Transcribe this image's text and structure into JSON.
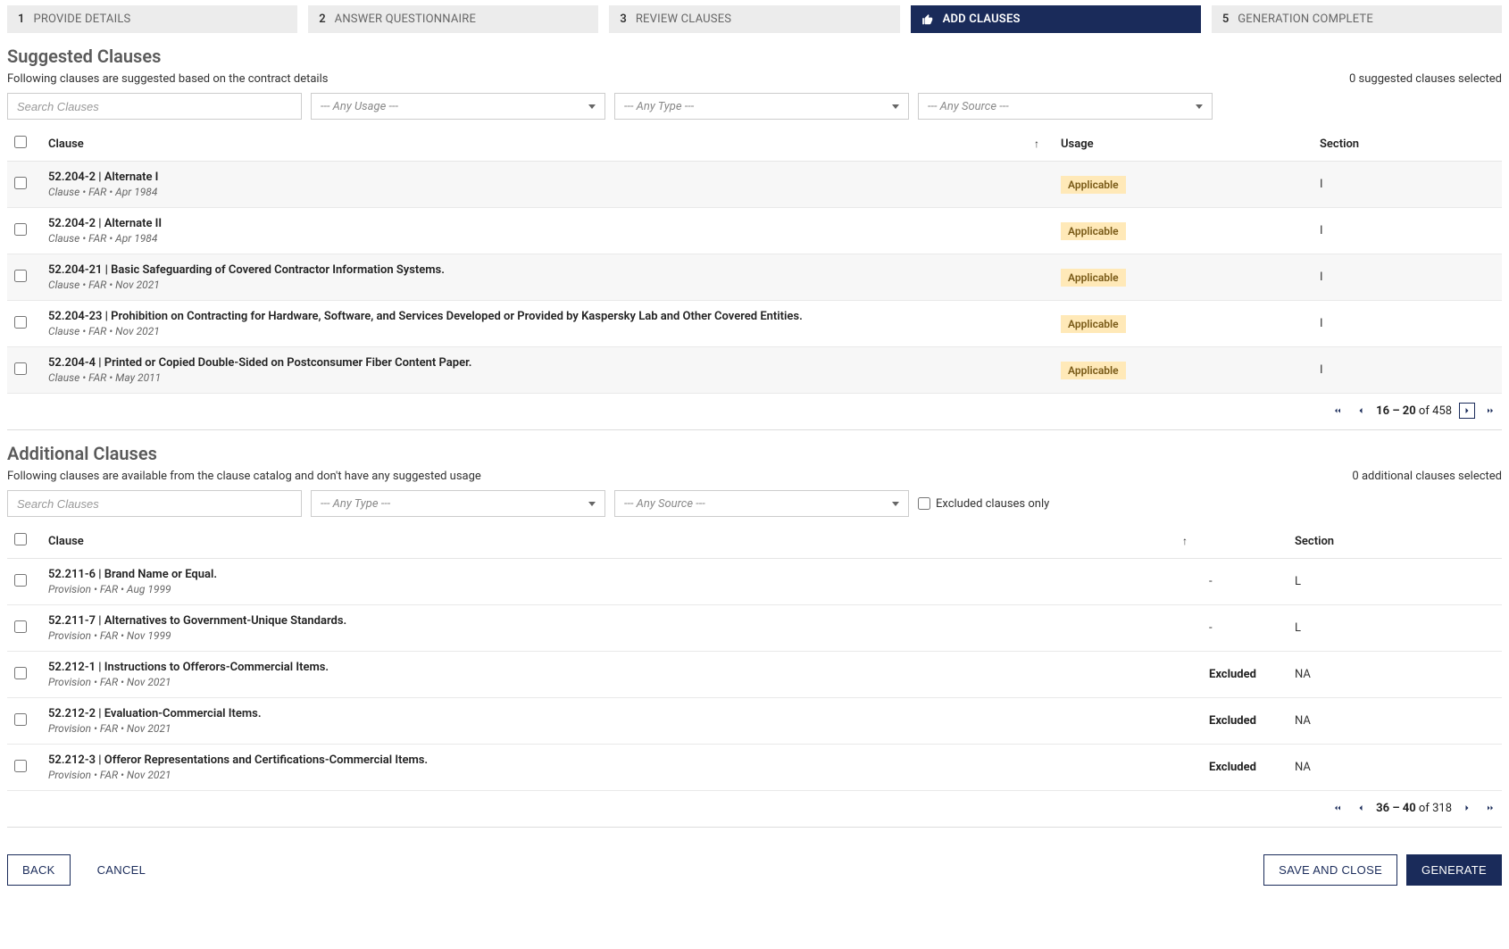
{
  "wizard": {
    "steps": [
      {
        "num": "1",
        "label": "PROVIDE DETAILS"
      },
      {
        "num": "2",
        "label": "ANSWER QUESTIONNAIRE"
      },
      {
        "num": "3",
        "label": "REVIEW CLAUSES"
      },
      {
        "num": "4",
        "label": "ADD CLAUSES",
        "active": true
      },
      {
        "num": "5",
        "label": "GENERATION COMPLETE"
      }
    ]
  },
  "suggested": {
    "title": "Suggested Clauses",
    "desc": "Following clauses are suggested based on the contract details",
    "selected_text": "0 suggested clauses selected",
    "filters": {
      "search_placeholder": "Search Clauses",
      "usage_placeholder": "--- Any Usage ---",
      "type_placeholder": "--- Any Type ---",
      "source_placeholder": "--- Any Source ---"
    },
    "headers": {
      "clause": "Clause",
      "usage": "Usage",
      "section": "Section"
    },
    "rows": [
      {
        "title": "52.204-2 | Alternate I",
        "meta": "Clause • FAR • Apr 1984",
        "usage": "Applicable",
        "section": "I"
      },
      {
        "title": "52.204-2 | Alternate II",
        "meta": "Clause • FAR • Apr 1984",
        "usage": "Applicable",
        "section": "I"
      },
      {
        "title": "52.204-21 | Basic Safeguarding of Covered Contractor Information Systems.",
        "meta": "Clause • FAR • Nov 2021",
        "usage": "Applicable",
        "section": "I"
      },
      {
        "title": "52.204-23 | Prohibition on Contracting for Hardware, Software, and Services Developed or Provided by Kaspersky Lab and Other Covered Entities.",
        "meta": "Clause • FAR • Nov 2021",
        "usage": "Applicable",
        "section": "I"
      },
      {
        "title": "52.204-4 | Printed or Copied Double-Sided on Postconsumer Fiber Content Paper.",
        "meta": "Clause • FAR • May 2011",
        "usage": "Applicable",
        "section": "I"
      }
    ],
    "pagination": {
      "range": "16 – 20",
      "of": "of",
      "total": "458"
    }
  },
  "additional": {
    "title": "Additional Clauses",
    "desc": "Following clauses are available from the clause catalog and don't have any suggested usage",
    "selected_text": "0 additional clauses selected",
    "filters": {
      "search_placeholder": "Search Clauses",
      "type_placeholder": "--- Any Type ---",
      "source_placeholder": "--- Any Source ---",
      "excluded_label": "Excluded clauses only"
    },
    "headers": {
      "clause": "Clause",
      "section": "Section"
    },
    "rows": [
      {
        "title": "52.211-6 | Brand Name or Equal.",
        "meta": "Provision • FAR • Aug 1999",
        "usage": "-",
        "section": "L"
      },
      {
        "title": "52.211-7 | Alternatives to Government-Unique Standards.",
        "meta": "Provision • FAR • Nov 1999",
        "usage": "-",
        "section": "L"
      },
      {
        "title": "52.212-1 | Instructions to Offerors-Commercial Items.",
        "meta": "Provision • FAR • Nov 2021",
        "usage": "Excluded",
        "section": "NA"
      },
      {
        "title": "52.212-2 | Evaluation-Commercial Items.",
        "meta": "Provision • FAR • Nov 2021",
        "usage": "Excluded",
        "section": "NA"
      },
      {
        "title": "52.212-3 | Offeror Representations and Certifications-Commercial Items.",
        "meta": "Provision • FAR • Nov 2021",
        "usage": "Excluded",
        "section": "NA"
      }
    ],
    "pagination": {
      "range": "36 – 40",
      "of": "of",
      "total": "318"
    }
  },
  "footer": {
    "back": "BACK",
    "cancel": "CANCEL",
    "save_close": "SAVE AND CLOSE",
    "generate": "GENERATE"
  }
}
